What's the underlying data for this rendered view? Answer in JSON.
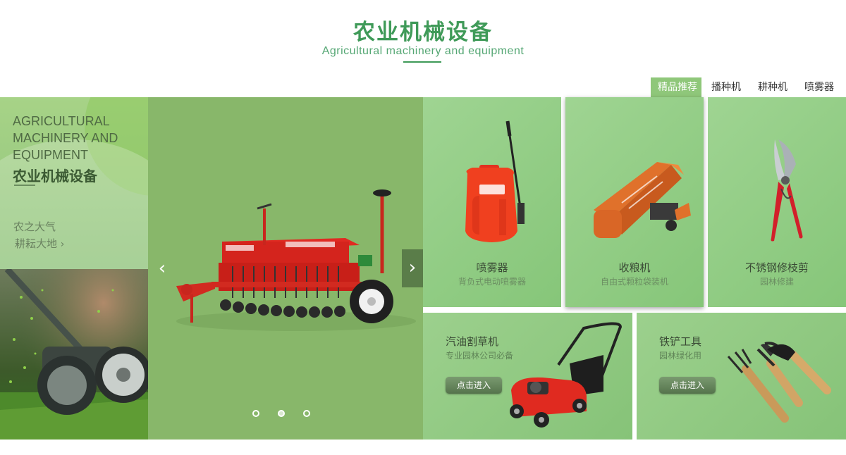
{
  "header": {
    "title": "农业机械设备",
    "subtitle": "Agricultural machinery and equipment"
  },
  "tabs": [
    {
      "label": "精品推荐",
      "active": true
    },
    {
      "label": "播种机",
      "active": false
    },
    {
      "label": "耕种机",
      "active": false
    },
    {
      "label": "喷雾器",
      "active": false
    }
  ],
  "intro": {
    "english": "AGRICULTURAL MACHINERY AND EQUIPMENT",
    "chinese": "农业机械设备",
    "line1": "农之大气",
    "line2": "耕耘大地",
    "line2_arrow": "›"
  },
  "carousel": {
    "prev_icon": "‹",
    "next_icon": "›",
    "slides_count": 3,
    "active_slide": 2
  },
  "products": [
    {
      "name": "喷雾器",
      "desc": "背负式电动喷雾器",
      "icon": "sprayer-image"
    },
    {
      "name": "收粮机",
      "desc": "自由式颗粒袋装机",
      "icon": "grain-collector-image"
    },
    {
      "name": "不锈钢修枝剪",
      "desc": "园林修建",
      "icon": "pruning-shears-image"
    }
  ],
  "featured": [
    {
      "name": "汽油割草机",
      "desc": "专业园林公司必备",
      "button": "点击进入",
      "icon": "lawn-mower-image"
    },
    {
      "name": "铁铲工具",
      "desc": "园林绿化用",
      "button": "点击进入",
      "icon": "garden-tools-image"
    }
  ],
  "colors": {
    "brand_green": "#3f9a58",
    "tab_active": "#8fc77a",
    "carousel_bg": "#88b76a",
    "card_bg": "#9fd492"
  }
}
